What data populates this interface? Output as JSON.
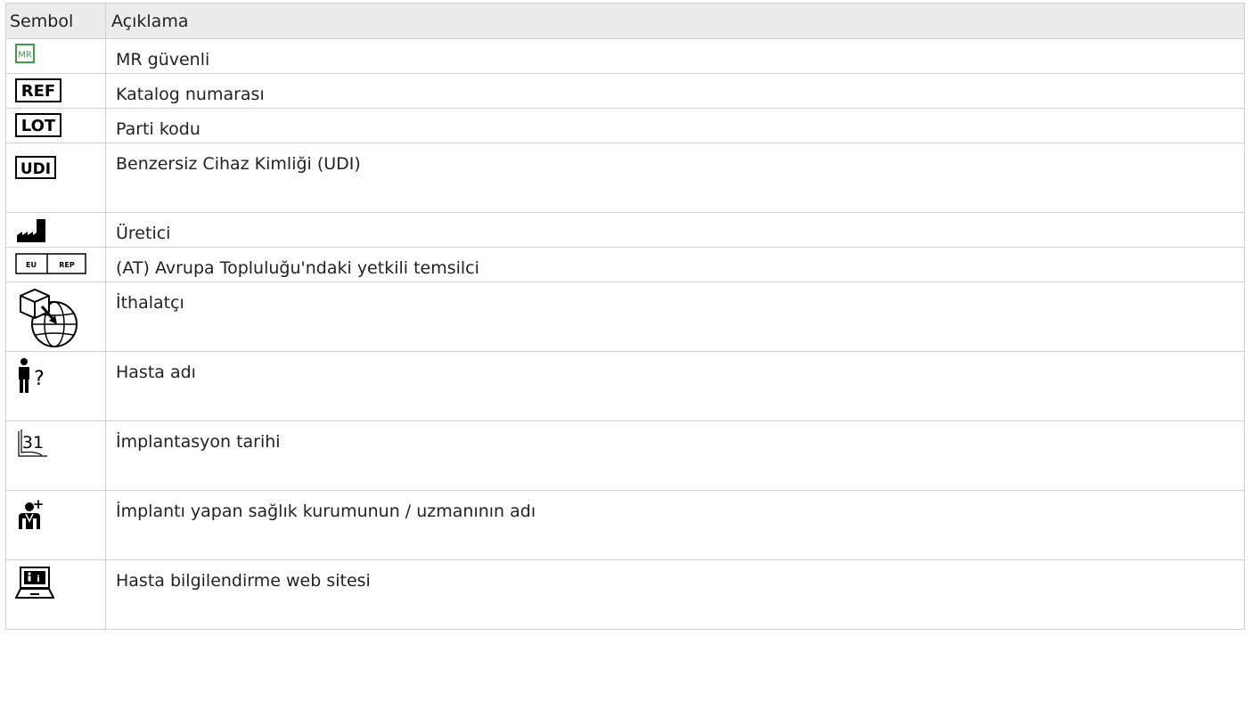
{
  "table": {
    "headers": [
      "Sembol",
      "Açıklama"
    ],
    "rows": [
      {
        "icon": "mr-safe-icon",
        "label": "MR güvenli",
        "icon_text": "MR"
      },
      {
        "icon": "ref-catalog-icon",
        "label": "Katalog numarası",
        "icon_text": "REF"
      },
      {
        "icon": "lot-batch-icon",
        "label": "Parti kodu",
        "icon_text": "LOT"
      },
      {
        "icon": "udi-icon",
        "label": "Benzersiz Cihaz Kimliği (UDI)",
        "icon_text": "UDI"
      },
      {
        "icon": "manufacturer-icon",
        "label": "Üretici"
      },
      {
        "icon": "eu-rep-icon",
        "label": "(AT) Avrupa Topluluğu'ndaki yetkili temsilci",
        "icon_text": [
          "EU",
          "REP"
        ]
      },
      {
        "icon": "importer-icon",
        "label": "İthalatçı"
      },
      {
        "icon": "patient-name-icon",
        "label": "Hasta adı",
        "icon_text": "?"
      },
      {
        "icon": "implant-date-icon",
        "label": "İmplantasyon tarihi",
        "icon_text": "31"
      },
      {
        "icon": "healthcare-provider-icon",
        "label": "İmplantı yapan sağlık kurumunun / uzmanının adı",
        "icon_text": "+"
      },
      {
        "icon": "patient-info-website-icon",
        "label": "Hasta bilgilendirme web sitesi",
        "icon_text": "i"
      }
    ]
  },
  "colors": {
    "header_bg": "#ececec",
    "border": "#cfcfcf",
    "mr_green": "#3f9a4a"
  }
}
